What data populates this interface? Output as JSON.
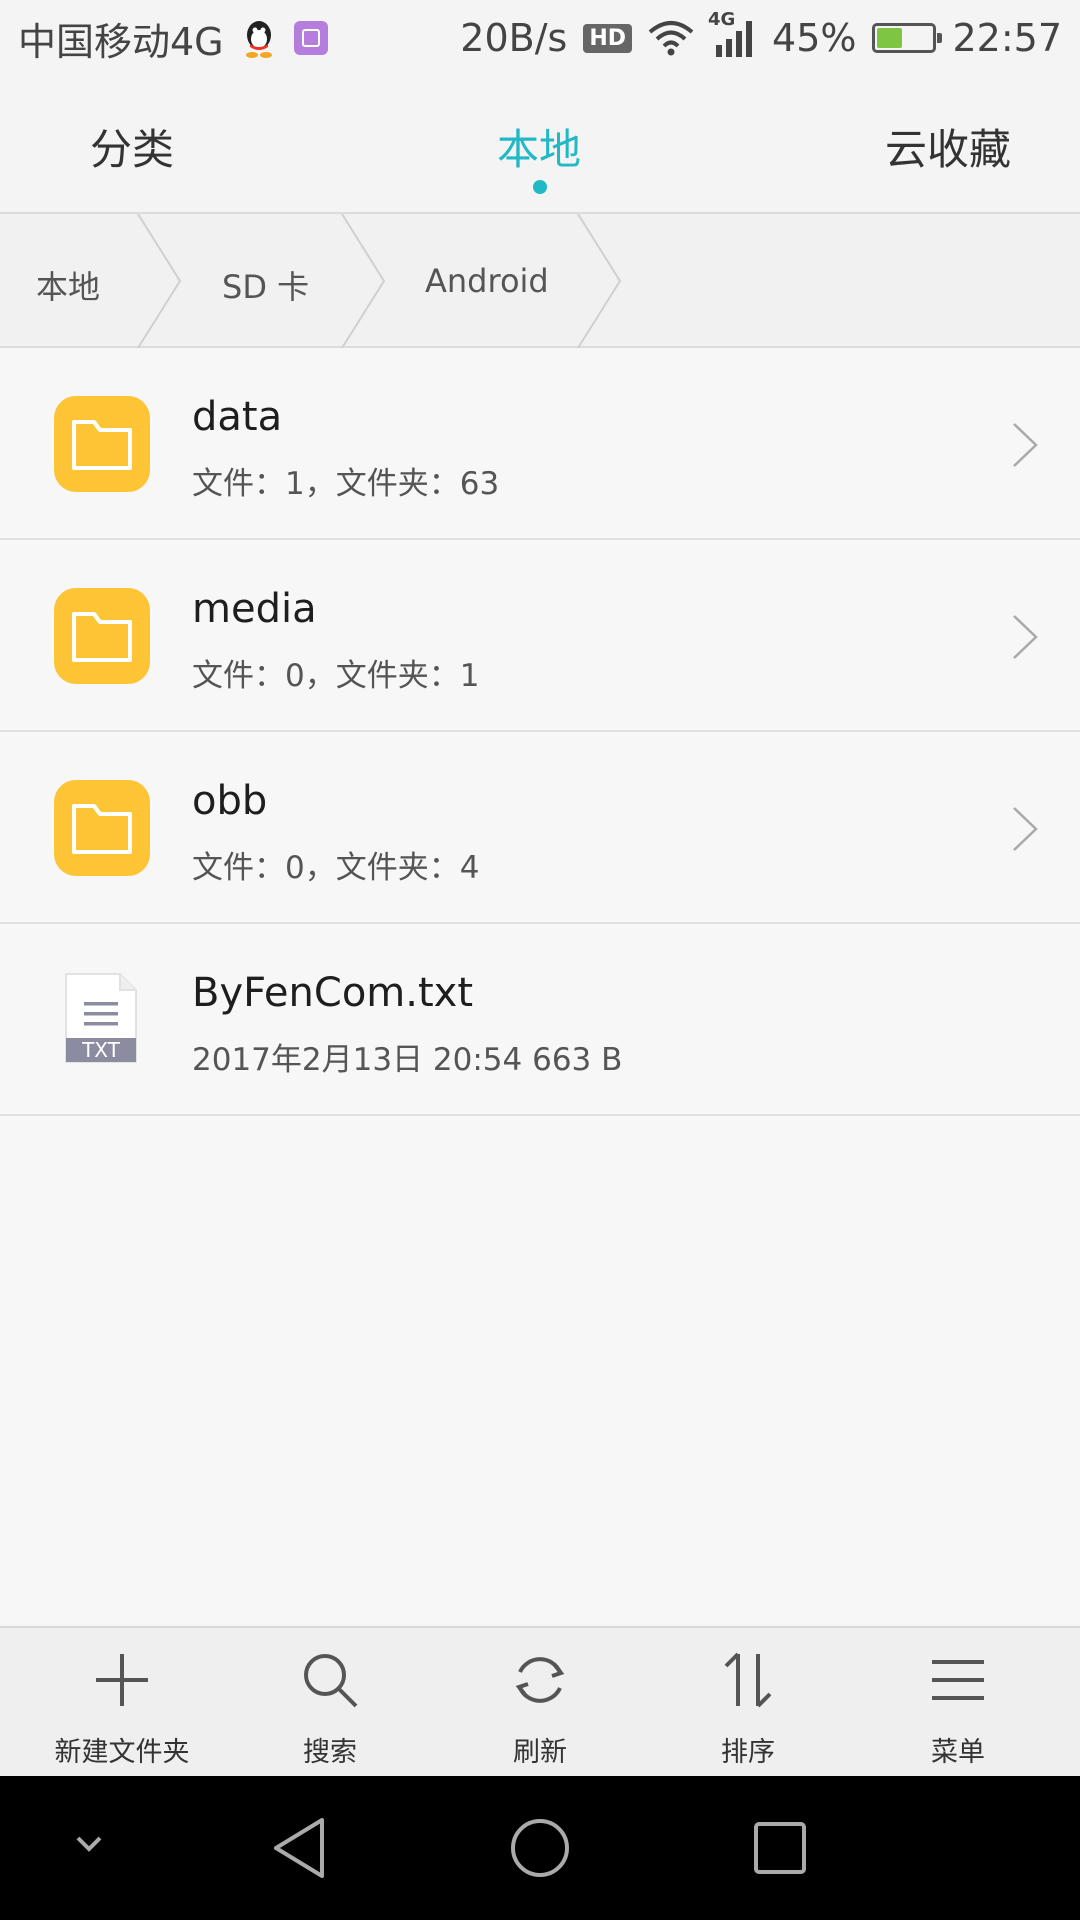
{
  "status_bar": {
    "carrier": "中国移动4G",
    "net_speed": "20B/s",
    "hd_badge": "HD",
    "network_type": "4G",
    "battery_percent": "45%",
    "time": "22:57",
    "battery_level": 0.45
  },
  "tabs": [
    {
      "label": "分类",
      "active": false
    },
    {
      "label": "本地",
      "active": true
    },
    {
      "label": "云收藏",
      "active": false
    }
  ],
  "breadcrumb": [
    "本地",
    "SD 卡",
    "Android"
  ],
  "files": [
    {
      "name": "data",
      "meta": "文件：1，文件夹：63",
      "type": "folder"
    },
    {
      "name": "media",
      "meta": "文件：0，文件夹：1",
      "type": "folder"
    },
    {
      "name": "obb",
      "meta": "文件：0，文件夹：4",
      "type": "folder"
    },
    {
      "name": "ByFenCom.txt",
      "meta": "2017年2月13日 20:54 663 B",
      "type": "txt",
      "badge": "TXT"
    }
  ],
  "toolbar": {
    "new_folder": "新建文件夹",
    "search": "搜索",
    "refresh": "刷新",
    "sort": "排序",
    "menu": "菜单"
  },
  "colors": {
    "accent": "#22b8c4",
    "folder": "#fdc535",
    "txt_badge": "#8c8ca0"
  }
}
